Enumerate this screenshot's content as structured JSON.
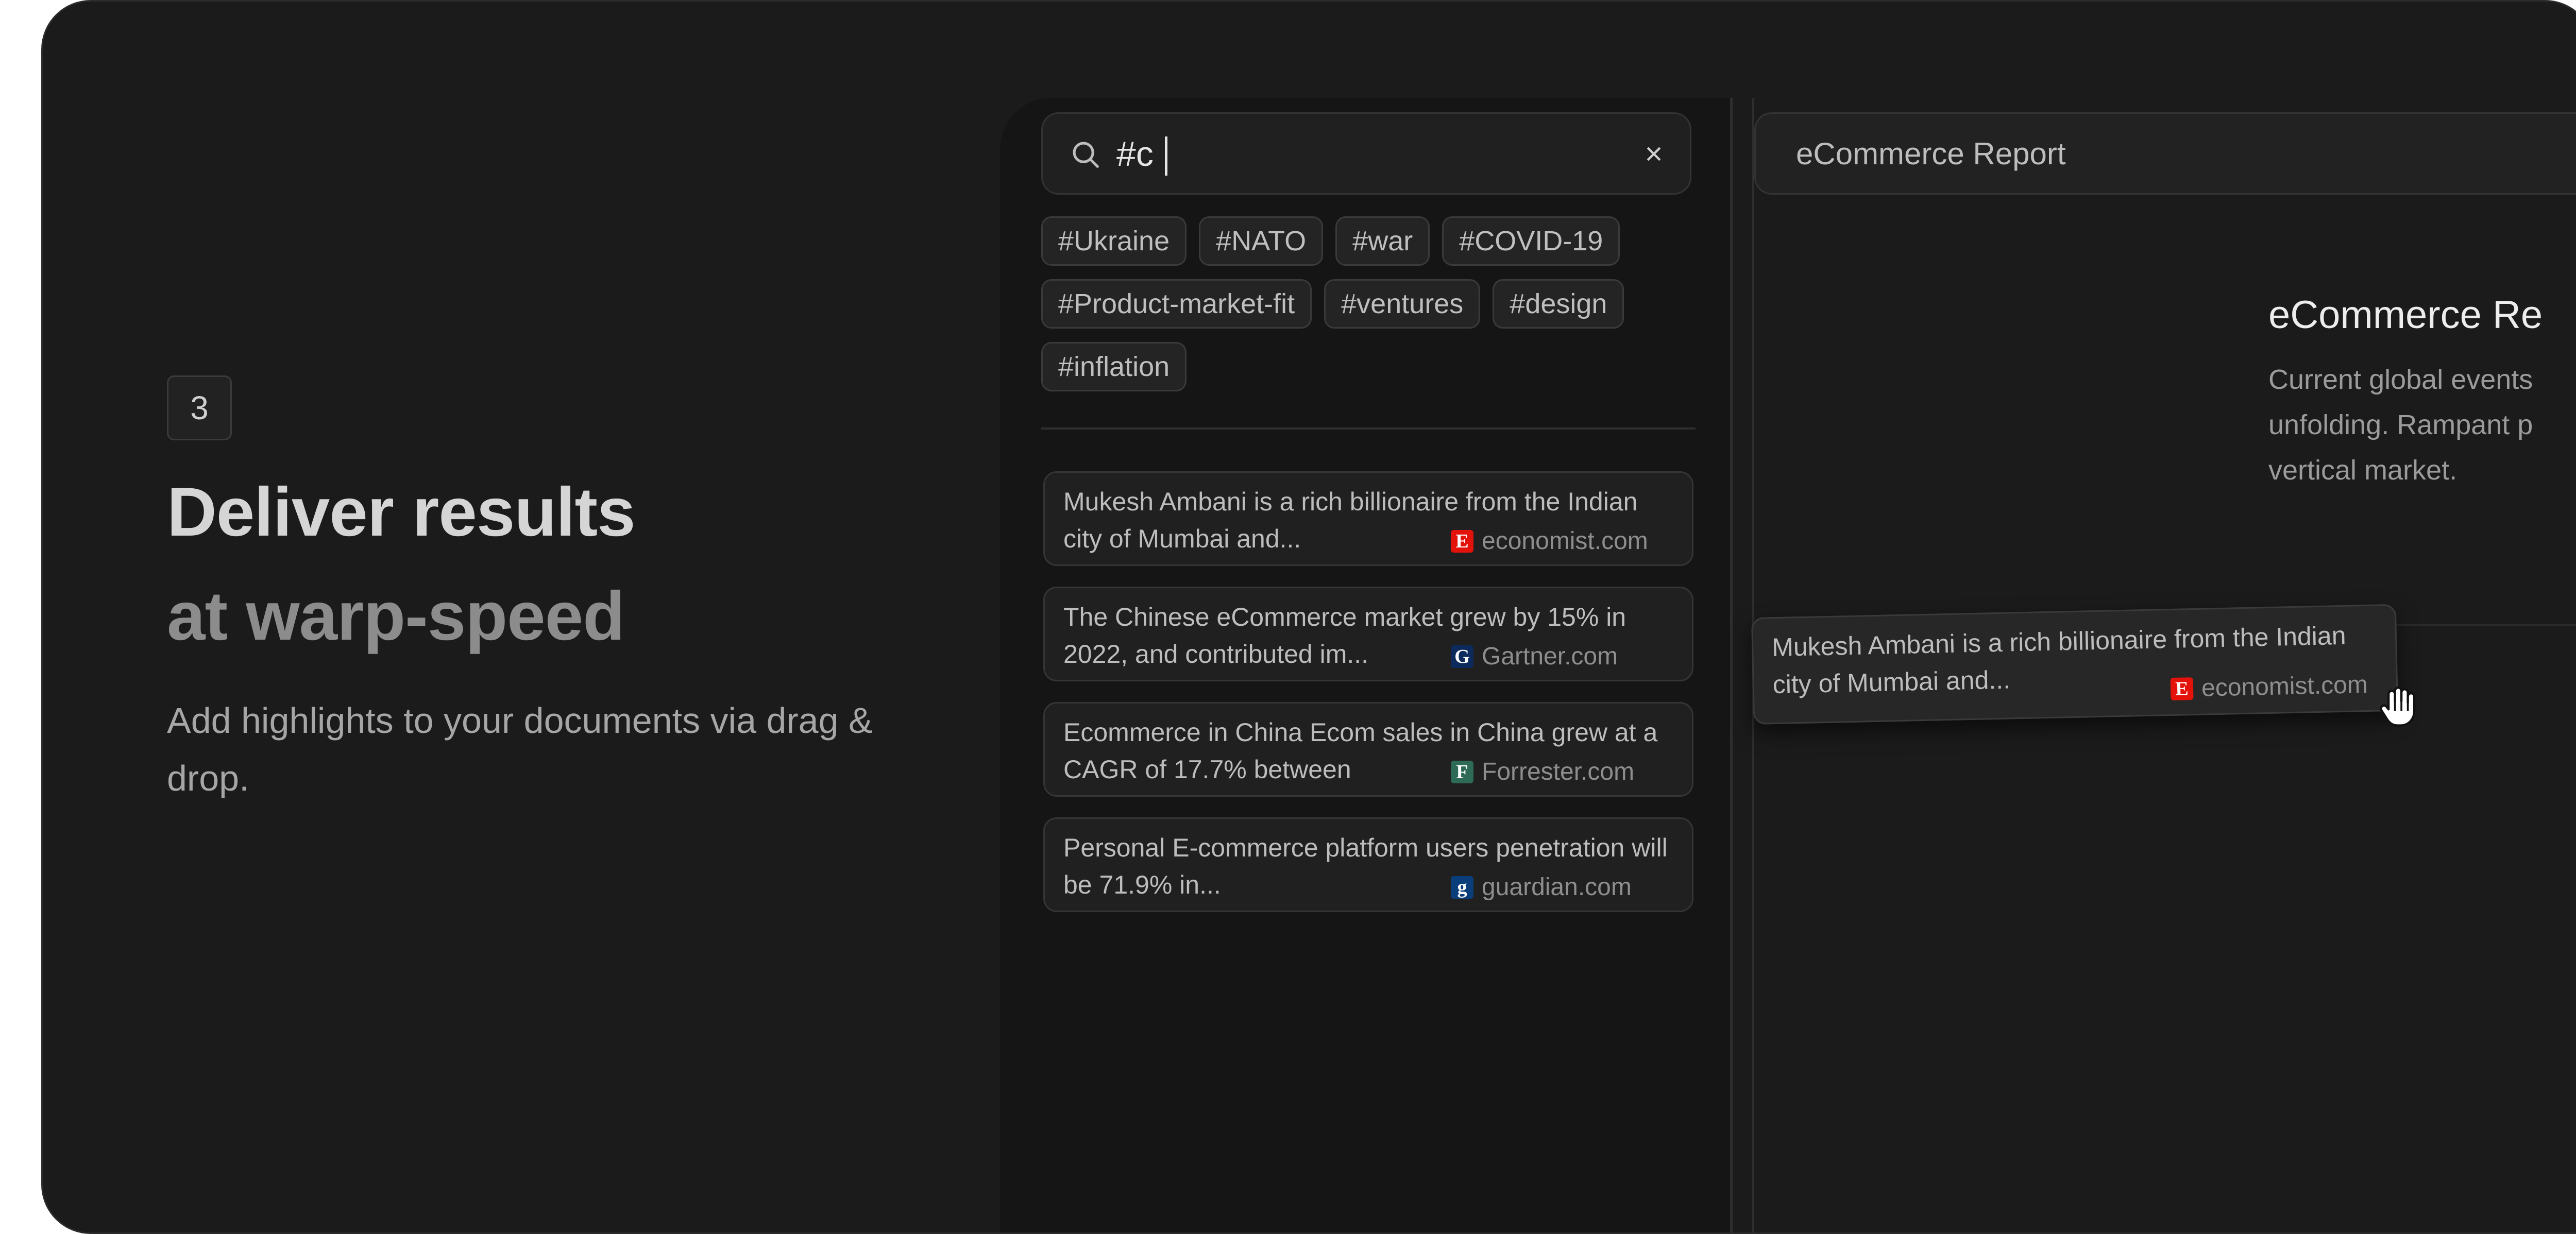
{
  "hero": {
    "step": "3",
    "title_line1": "Deliver results",
    "title_line2": "at warp-speed",
    "description": "Add highlights to your documents via drag & drop."
  },
  "search": {
    "query": "#c",
    "icon": "search-icon",
    "clear_icon": "×",
    "tags": [
      "#Ukraine",
      "#NATO",
      "#war",
      "#COVID-19",
      "#Product-market-fit",
      "#ventures",
      "#design",
      "#inflation"
    ]
  },
  "results": [
    {
      "text": "Mukesh Ambani is a rich billionaire from the Indian city of Mumbai and...",
      "source_logo": "E",
      "source_color": "#e3120b",
      "source": "economist.com"
    },
    {
      "text": "The Chinese eCommerce market grew by 15% in 2022, and contributed im...",
      "source_logo": "G",
      "source_color": "#0c2a5b",
      "source": "Gartner.com"
    },
    {
      "text": "Ecommerce in China Ecom sales in China grew at a CAGR of 17.7% between",
      "source_logo": "F",
      "source_color": "#2e6b57",
      "source": "Forrester.com"
    },
    {
      "text": "Personal E-commerce platform users penetration will be 71.9% in...",
      "source_logo": "g",
      "source_color": "#0a3e7a",
      "source": "guardian.com"
    }
  ],
  "document": {
    "tab_title": "eCommerce Report",
    "title": "eCommerce Re",
    "body_lines": [
      "Current global events",
      "unfolding. Rampant p",
      "vertical market."
    ]
  },
  "dragged": {
    "text": "Mukesh Ambani is a rich billionaire from the Indian city of Mumbai and...",
    "source_logo": "E",
    "source_color": "#e3120b",
    "source": "economist.com"
  }
}
